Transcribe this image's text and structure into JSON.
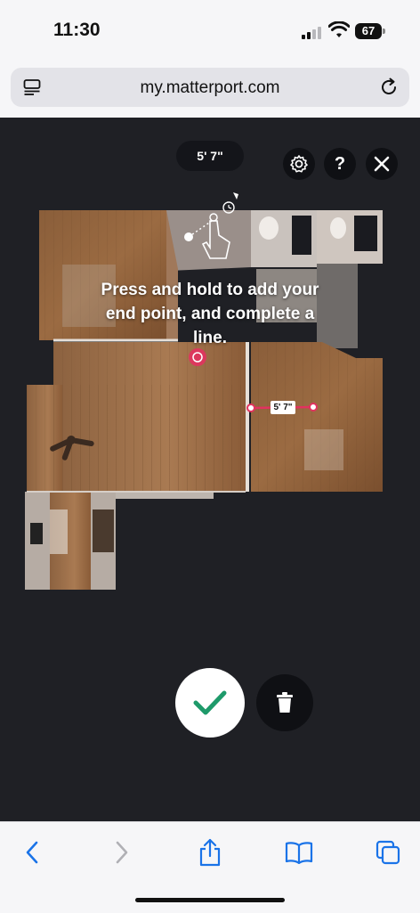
{
  "status": {
    "time": "11:30",
    "battery": "67"
  },
  "browser": {
    "url": "my.matterport.com"
  },
  "viewer": {
    "measurement_pill": "5' 7\"",
    "instruction": "Press and hold to add your end point, and complete a line.",
    "tape_label": "5' 7\""
  },
  "icons": {
    "settings": "gear-icon",
    "help": "?",
    "close": "close-icon",
    "confirm": "checkmark-icon",
    "delete": "trash-icon",
    "back": "chevron-left-icon",
    "forward": "chevron-right-icon",
    "share": "share-icon",
    "bookmarks": "book-icon",
    "tabs": "tabs-icon"
  },
  "colors": {
    "viewer_bg": "#1f2025",
    "accent_pink": "#e2325f",
    "confirm_green": "#1e9a6a"
  }
}
